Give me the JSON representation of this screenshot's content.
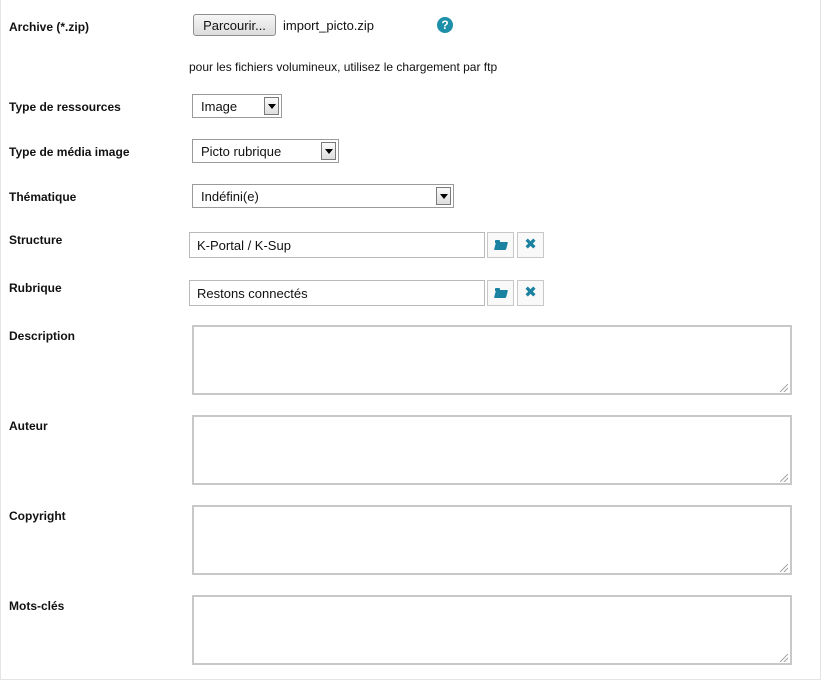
{
  "archive": {
    "label": "Archive (*.zip)",
    "browse_label": "Parcourir...",
    "filename": "import_picto.zip",
    "help_icon": "help-icon",
    "hint": "pour les fichiers volumineux, utilisez le chargement par ftp"
  },
  "type_ressources": {
    "label": "Type de ressources",
    "value": "Image"
  },
  "type_media": {
    "label": "Type de média image",
    "value": "Picto rubrique"
  },
  "thematique": {
    "label": "Thématique",
    "value": "Indéfini(e)"
  },
  "structure": {
    "label": "Structure",
    "value": "K-Portal / K-Sup"
  },
  "rubrique": {
    "label": "Rubrique",
    "value": "Restons connectés"
  },
  "description": {
    "label": "Description",
    "value": ""
  },
  "auteur": {
    "label": "Auteur",
    "value": ""
  },
  "copyright": {
    "label": "Copyright",
    "value": ""
  },
  "mots_cles": {
    "label": "Mots-clés",
    "value": ""
  },
  "colors": {
    "accent": "#1a82a0",
    "border": "#c8c8c8"
  },
  "icons": {
    "browse": "folder-open-icon",
    "clear": "close-icon",
    "select": "chevron-down-icon"
  }
}
